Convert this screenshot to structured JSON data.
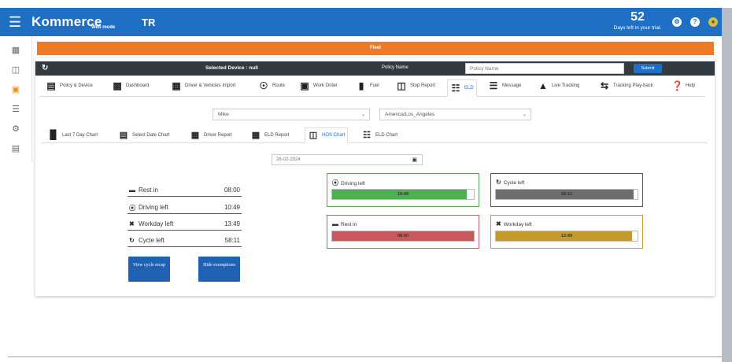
{
  "header": {
    "brand": "Kommerce",
    "brand_sub": "Web mode",
    "lang": "TR",
    "trial_days": "52",
    "trial_text": "Days left in your trial.",
    "icons": [
      "settings-icon",
      "help-icon",
      "avatar-icon"
    ]
  },
  "rail": {
    "icons": [
      "dashboard-icon",
      "folder-icon",
      "orders-icon",
      "list-icon",
      "gear-icon",
      "report-icon"
    ],
    "active": "orders-icon"
  },
  "banner": {
    "label": "Fleet"
  },
  "devicebar": {
    "refresh_icon": "refresh-icon",
    "selected_device": "Selected Device : null",
    "policy_label": "Policy Name",
    "policy_placeholder": "Policy Name",
    "submit": "Submit"
  },
  "tabs": [
    {
      "label": "Policy & Device",
      "icon": "policy-icon"
    },
    {
      "label": "Dashboard",
      "icon": "dashboard-icon"
    },
    {
      "label": "Driver & Vehicles Import",
      "icon": "import-icon"
    },
    {
      "label": "Route",
      "icon": "route-icon"
    },
    {
      "label": "Work Order",
      "icon": "work-order-icon"
    },
    {
      "label": "Fuel",
      "icon": "fuel-icon"
    },
    {
      "label": "Stop Report",
      "icon": "stop-report-icon"
    },
    {
      "label": "ELD",
      "icon": "eld-icon"
    },
    {
      "label": "Message",
      "icon": "message-icon"
    },
    {
      "label": "Live Tracking",
      "icon": "car-icon"
    },
    {
      "label": "Tracking Play-back",
      "icon": "playback-icon"
    },
    {
      "label": "Help",
      "icon": "help-icon"
    }
  ],
  "active_tab": "ELD",
  "filters": {
    "driver": "Mike",
    "timezone": "America/Los_Angeles"
  },
  "subtabs": [
    {
      "label": "Last 7 Day Chart",
      "icon": "bar-chart-icon"
    },
    {
      "label": "Select Date Chart",
      "icon": "calendar-list-icon"
    },
    {
      "label": "Driver Report",
      "icon": "driver-report-icon"
    },
    {
      "label": "ELD Report",
      "icon": "eld-report-icon"
    },
    {
      "label": "HOS Chart",
      "icon": "hos-chart-icon"
    },
    {
      "label": "ELD Chart",
      "icon": "eld-chart-icon"
    }
  ],
  "active_subtab": "HOS Chart",
  "date": "26-02-2024",
  "summary": [
    {
      "label": "Rest in",
      "value": "08:00",
      "icon": "bed-icon"
    },
    {
      "label": "Driving left",
      "value": "10:49",
      "icon": "steering-wheel-icon"
    },
    {
      "label": "Workday left",
      "value": "13:49",
      "icon": "tools-icon"
    },
    {
      "label": "Cycle left",
      "value": "58:11",
      "icon": "cycle-icon"
    }
  ],
  "buttons": {
    "view_cycle": "View cycle recap",
    "hide_exemptions": "Hide exemptions"
  },
  "gauges": [
    {
      "label": "Driving left",
      "value": "10:49",
      "icon": "steering-wheel-icon",
      "fill_fraction": 0.95,
      "color": "#4caf50",
      "border": "#5aa55a"
    },
    {
      "label": "Cycle left",
      "value": "58:11",
      "icon": "cycle-icon",
      "fill_fraction": 0.97,
      "color": "#6d6d6d",
      "border": "#555555"
    },
    {
      "label": "Rest in",
      "value": "08:00",
      "icon": "bed-icon",
      "fill_fraction": 1.0,
      "color": "#c9585c",
      "border": "#c95a70"
    },
    {
      "label": "Workday left",
      "value": "13:49",
      "icon": "tools-icon",
      "fill_fraction": 0.96,
      "color": "#c49a2c",
      "border": "#c49a2c"
    }
  ]
}
